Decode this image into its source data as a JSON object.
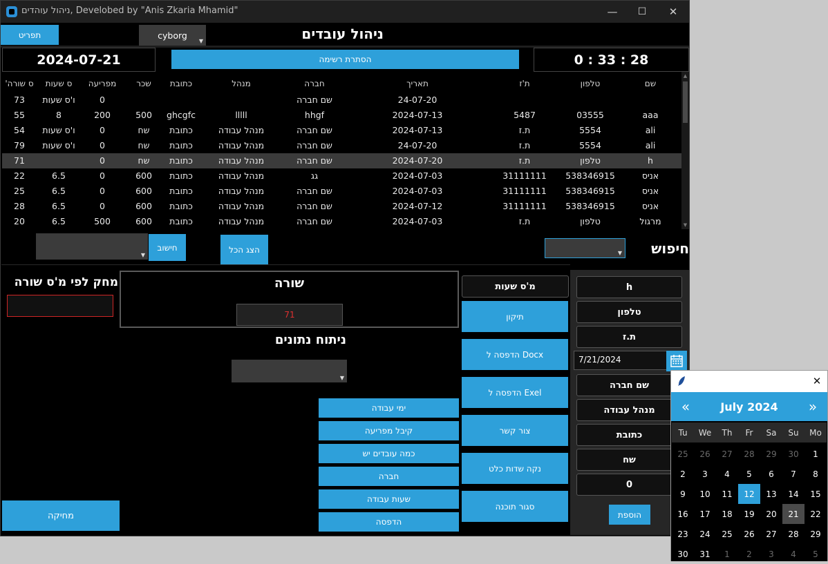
{
  "window": {
    "title": "ניהול עוהדים, Develobed by \"Anis Zkaria Mhamid\"",
    "controls": {
      "minimize": "—",
      "maximize": "☐",
      "close": "✕"
    }
  },
  "header": {
    "menu_button": "תפריט",
    "theme_combo": "cyborg",
    "page_title": "ניהול עובדים",
    "date": "2024-07-21",
    "hide_list_button": "הסתרת רשימה",
    "clock": "0 : 33 : 28"
  },
  "table": {
    "columns": [
      "שם",
      "טלפון",
      "ת'ז",
      "תאריך",
      "חברה",
      "מנהל",
      "כתובת",
      "שכר",
      "מפריעה",
      "ס שעות",
      "'ס שורה"
    ],
    "rows": [
      [
        "",
        "",
        "",
        "24-07-20",
        "שם חברה",
        "",
        "",
        "",
        "0",
        "ו'ס שעות",
        "73"
      ],
      [
        "aaa",
        "03555",
        "5487",
        "2024-07-13",
        "hhgf",
        "lllll",
        "ghcgfc",
        "500",
        "200",
        "8",
        "55"
      ],
      [
        "ali",
        "5554",
        "ת.ז",
        "2024-07-13",
        "שם חברה",
        "מנהל עבודה",
        "כתובת",
        "שח",
        "0",
        "ו'ס שעות",
        "54"
      ],
      [
        "ali",
        "5554",
        "ת.ז",
        "24-07-20",
        "שם חברה",
        "מנהל עבודה",
        "כתובת",
        "שח",
        "0",
        "ו'ס שעות",
        "79"
      ],
      [
        "h",
        "טלפון",
        "ת.ז",
        "2024-07-20",
        "שם חברה",
        "מנהל עבודה",
        "כתובת",
        "שח",
        "0",
        "",
        "71"
      ],
      [
        "אניס",
        "538346915",
        "31111111",
        "2024-07-03",
        "גג",
        "מנהל עבודה",
        "כתובת",
        "600",
        "0",
        "6.5",
        "22"
      ],
      [
        "אניס",
        "538346915",
        "31111111",
        "2024-07-03",
        "שם חברה",
        "מנהל עבודה",
        "כתובת",
        "600",
        "0",
        "6.5",
        "25"
      ],
      [
        "אניס",
        "538346915",
        "31111111",
        "2024-07-12",
        "שם חברה",
        "מנהל עבודה",
        "כתובת",
        "600",
        "0",
        "6.5",
        "28"
      ],
      [
        "מרגול",
        "טלפון",
        "ת.ז",
        "2024-07-03",
        "שם חברה",
        "מנהל עבודה",
        "כתובת",
        "600",
        "500",
        "6.5",
        "20"
      ]
    ]
  },
  "search": {
    "label": "חיפוש",
    "show_all_button": "הצג הכל",
    "calc_button": "חישוב"
  },
  "delete_panel": {
    "title": "מחק לפי מ'ס שורה",
    "delete_button": "מחיקה"
  },
  "row_panel": {
    "title": "שורה",
    "value": "71"
  },
  "analysis": {
    "title": "ניתוח נתונים",
    "buttons": [
      "ימי עבודה",
      "קיבל מפריעה",
      "כמה עובדים יש",
      "חברה",
      "שעות עבודה",
      "הדפסה"
    ]
  },
  "actions": {
    "hours_label": "מ'ס שעות",
    "buttons": [
      "תיקון",
      "הדפסה ל Docx",
      "הדפסה ל Exel",
      "צור קשר",
      "נקה שדות כלט",
      "סגור תוכנה"
    ]
  },
  "form": {
    "name": "h",
    "phone": "טלפון",
    "id": "ת.ז",
    "date": "7/21/2024",
    "company": "שם חברה",
    "manager": "מנהל עבודה",
    "address": "כתובת",
    "salary": "שח",
    "hours": "0",
    "add_button": "הוספת"
  },
  "calendar": {
    "month_label": "July 2024",
    "prev": "«",
    "next": "»",
    "close": "✕",
    "weekdays": [
      "Tu",
      "We",
      "Th",
      "Fr",
      "Sa",
      "Su",
      "Mo"
    ],
    "weeks": [
      [
        "25",
        "26",
        "27",
        "28",
        "29",
        "30",
        "1"
      ],
      [
        "2",
        "3",
        "4",
        "5",
        "6",
        "7",
        "8"
      ],
      [
        "9",
        "10",
        "11",
        "12",
        "13",
        "14",
        "15"
      ],
      [
        "16",
        "17",
        "18",
        "19",
        "20",
        "21",
        "22"
      ],
      [
        "23",
        "24",
        "25",
        "26",
        "27",
        "28",
        "29"
      ],
      [
        "30",
        "31",
        "1",
        "2",
        "3",
        "4",
        "5"
      ]
    ],
    "selected_day": "12",
    "today_day": "21"
  },
  "colors": {
    "accent": "#2ea0da",
    "background": "#000000",
    "selected_row": "#3b3b3b",
    "error": "#e03030"
  }
}
